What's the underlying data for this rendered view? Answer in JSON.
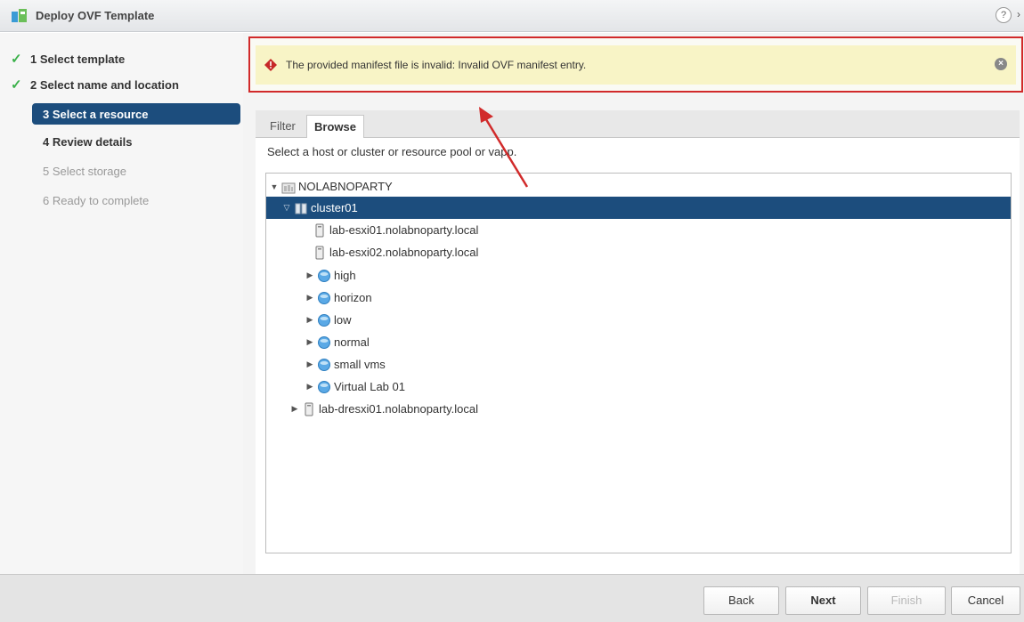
{
  "window": {
    "title": "Deploy OVF Template",
    "help_glyph": "?",
    "more_glyph": "›"
  },
  "steps": [
    {
      "label": "1 Select template",
      "state": "done"
    },
    {
      "label": "2 Select name and location",
      "state": "done"
    },
    {
      "label": "3 Select a resource",
      "state": "active"
    },
    {
      "label": "4 Review details",
      "state": "pending"
    },
    {
      "label": "5 Select storage",
      "state": "disabled"
    },
    {
      "label": "6 Ready to complete",
      "state": "disabled"
    }
  ],
  "error": {
    "message": "The provided manifest file is invalid: Invalid OVF manifest entry.",
    "close_glyph": "×"
  },
  "tabs": {
    "filter": "Filter",
    "browse": "Browse",
    "selected": "Browse"
  },
  "instruction": "Select a host or cluster or resource pool or vapp.",
  "tree": [
    {
      "label": "NOLABNOPARTY",
      "icon": "datacenter-icon",
      "expanded": true
    },
    {
      "label": "cluster01",
      "icon": "cluster-icon",
      "expanded": true,
      "selected": true
    },
    {
      "label": "lab-esxi01.nolabnoparty.local",
      "icon": "host-icon"
    },
    {
      "label": "lab-esxi02.nolabnoparty.local",
      "icon": "host-icon"
    },
    {
      "label": "high",
      "icon": "resource-pool-icon",
      "expanded": false
    },
    {
      "label": "horizon",
      "icon": "resource-pool-icon",
      "expanded": false
    },
    {
      "label": "low",
      "icon": "resource-pool-icon",
      "expanded": false
    },
    {
      "label": "normal",
      "icon": "resource-pool-icon",
      "expanded": false
    },
    {
      "label": "small vms",
      "icon": "resource-pool-icon",
      "expanded": false
    },
    {
      "label": "Virtual Lab 01",
      "icon": "resource-pool-icon",
      "expanded": false
    },
    {
      "label": "lab-dresxi01.nolabnoparty.local",
      "icon": "host-icon",
      "expanded": false
    }
  ],
  "buttons": {
    "back": "Back",
    "next": "Next",
    "finish": "Finish",
    "cancel": "Cancel"
  },
  "colors": {
    "selection": "#1c4d7d",
    "error_border": "#d12a2a",
    "error_background": "#f8f4c6",
    "check": "#3bb14a"
  }
}
